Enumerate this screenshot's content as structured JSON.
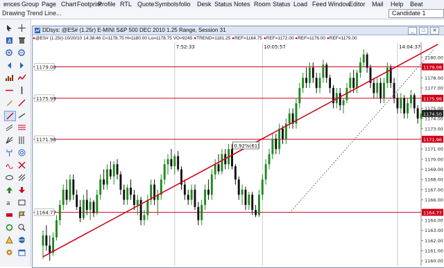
{
  "menu": [
    "ences",
    "Group",
    "Page",
    "Chart",
    "Footprint",
    "Profile",
    "RTL",
    "Quote",
    "Symbols",
    "folio",
    "Desk",
    "Status",
    "Notes",
    "Room",
    "Status",
    "Load",
    "Feed",
    "Window",
    "Editor",
    "Mail",
    "Help",
    "Beat"
  ],
  "status_bar": {
    "text": "Drawing Trend Line...",
    "symbol_box": "Candidate 1"
  },
  "chart_window": {
    "title": "DDsys: @ES# (1.25r) E-MINI S&P 500 DEC 2010 1.25 Range, Session 31",
    "info": {
      "symbol": "@ES# (1.25r)",
      "date": "10/20/10",
      "time": "14:38:46",
      "close": "C=1178.75",
      "high": "H=1180.00",
      "low": "Lo=1178.75",
      "volume": "VO=9245",
      "trend": "TREND=1181.25",
      "ref1": "REF=1164.75",
      "ref2": "REF=1172.00",
      "ref3": "REF=1176.00",
      "ref4": "REF=1179.00"
    },
    "colors": {
      "accent": "#d0021b",
      "window_border": "#7f93b5",
      "title_bg": "#dce6f4",
      "info_dot": "#d0021b",
      "bull": "#1f8a1f",
      "bear": "#111111"
    }
  },
  "chart_data": {
    "type": "candlestick",
    "y_axis_range": [
      1159.5,
      1181.5
    ],
    "y_ticks": [
      1180.0,
      1179.0,
      1178.0,
      1177.0,
      1176.0,
      1175.0,
      1174.0,
      1173.0,
      1172.0,
      1171.0,
      1170.0,
      1169.0,
      1168.0,
      1167.0,
      1166.0,
      1165.0,
      1164.0,
      1163.0,
      1162.0,
      1161.0,
      1160.0
    ],
    "ref_lines": [
      {
        "price": 1179.08,
        "label": "1179.08",
        "axis_label": "1179.08"
      },
      {
        "price": 1175.99,
        "label": "1175.99",
        "axis_label": "1175.99"
      },
      {
        "price": 1171.96,
        "label": "1171.96",
        "axis_label": "1171.96"
      },
      {
        "price": 1164.77,
        "label": "1164.77",
        "axis_label": "1164.77"
      }
    ],
    "last_price": "1174.50",
    "time_markers": [
      {
        "bar": 39,
        "label": "7:52:33"
      },
      {
        "bar": 65,
        "label": "10:05:57"
      },
      {
        "bar": 105,
        "label": "14:04:37"
      }
    ],
    "trend_line": {
      "from": {
        "bar": 0,
        "price": 1160.4
      },
      "to": {
        "bar": 117,
        "price": 1181.3
      }
    },
    "dotted_line": {
      "from": {
        "bar": 73,
        "price": 1164.7
      },
      "to": {
        "bar": 116,
        "price": 1180.9
      }
    },
    "annotation": "0.92%(61)",
    "candles": [
      {
        "o": 1161.5,
        "h": 1163.0,
        "l": 1160.2,
        "c": 1162.5
      },
      {
        "o": 1162.5,
        "h": 1163.5,
        "l": 1161.0,
        "c": 1161.5
      },
      {
        "o": 1161.5,
        "h": 1162.5,
        "l": 1160.0,
        "c": 1160.8
      },
      {
        "o": 1160.8,
        "h": 1162.8,
        "l": 1160.5,
        "c": 1162.3
      },
      {
        "o": 1162.3,
        "h": 1164.5,
        "l": 1162.0,
        "c": 1164.0
      },
      {
        "o": 1164.0,
        "h": 1166.0,
        "l": 1163.5,
        "c": 1165.5
      },
      {
        "o": 1165.5,
        "h": 1167.5,
        "l": 1165.0,
        "c": 1167.0
      },
      {
        "o": 1167.0,
        "h": 1168.0,
        "l": 1165.5,
        "c": 1166.0
      },
      {
        "o": 1166.0,
        "h": 1168.5,
        "l": 1165.8,
        "c": 1168.0
      },
      {
        "o": 1168.0,
        "h": 1168.5,
        "l": 1166.0,
        "c": 1166.5
      },
      {
        "o": 1166.5,
        "h": 1167.0,
        "l": 1165.0,
        "c": 1165.3
      },
      {
        "o": 1165.3,
        "h": 1166.0,
        "l": 1163.8,
        "c": 1164.2
      },
      {
        "o": 1164.2,
        "h": 1166.5,
        "l": 1164.0,
        "c": 1166.0
      },
      {
        "o": 1166.0,
        "h": 1167.0,
        "l": 1164.5,
        "c": 1165.0
      },
      {
        "o": 1165.0,
        "h": 1166.2,
        "l": 1164.0,
        "c": 1165.8
      },
      {
        "o": 1165.8,
        "h": 1166.0,
        "l": 1164.3,
        "c": 1164.7
      },
      {
        "o": 1164.7,
        "h": 1167.0,
        "l": 1164.5,
        "c": 1166.5
      },
      {
        "o": 1166.5,
        "h": 1168.5,
        "l": 1166.0,
        "c": 1168.0
      },
      {
        "o": 1168.0,
        "h": 1169.0,
        "l": 1167.0,
        "c": 1167.5
      },
      {
        "o": 1167.5,
        "h": 1169.5,
        "l": 1167.0,
        "c": 1169.0
      },
      {
        "o": 1169.0,
        "h": 1169.8,
        "l": 1168.0,
        "c": 1168.3
      },
      {
        "o": 1168.3,
        "h": 1169.8,
        "l": 1167.5,
        "c": 1169.5
      },
      {
        "o": 1169.5,
        "h": 1170.0,
        "l": 1168.0,
        "c": 1168.5
      },
      {
        "o": 1168.5,
        "h": 1168.8,
        "l": 1166.5,
        "c": 1167.0
      },
      {
        "o": 1167.0,
        "h": 1167.5,
        "l": 1165.5,
        "c": 1166.0
      },
      {
        "o": 1166.0,
        "h": 1167.5,
        "l": 1165.5,
        "c": 1167.2
      },
      {
        "o": 1167.2,
        "h": 1168.0,
        "l": 1166.0,
        "c": 1166.5
      },
      {
        "o": 1166.5,
        "h": 1167.0,
        "l": 1165.0,
        "c": 1165.5
      },
      {
        "o": 1165.5,
        "h": 1166.5,
        "l": 1164.5,
        "c": 1166.0
      },
      {
        "o": 1166.0,
        "h": 1166.3,
        "l": 1163.5,
        "c": 1164.0
      },
      {
        "o": 1164.0,
        "h": 1165.0,
        "l": 1163.5,
        "c": 1164.5
      },
      {
        "o": 1164.5,
        "h": 1166.5,
        "l": 1164.0,
        "c": 1166.0
      },
      {
        "o": 1166.0,
        "h": 1168.0,
        "l": 1165.5,
        "c": 1167.5
      },
      {
        "o": 1167.5,
        "h": 1168.0,
        "l": 1165.5,
        "c": 1166.0
      },
      {
        "o": 1166.0,
        "h": 1167.0,
        "l": 1164.5,
        "c": 1166.5
      },
      {
        "o": 1166.5,
        "h": 1168.5,
        "l": 1166.0,
        "c": 1168.0
      },
      {
        "o": 1168.0,
        "h": 1170.0,
        "l": 1167.5,
        "c": 1169.5
      },
      {
        "o": 1169.5,
        "h": 1170.5,
        "l": 1168.5,
        "c": 1170.0
      },
      {
        "o": 1170.0,
        "h": 1171.0,
        "l": 1169.0,
        "c": 1169.3
      },
      {
        "o": 1169.3,
        "h": 1170.5,
        "l": 1168.5,
        "c": 1170.3
      },
      {
        "o": 1170.3,
        "h": 1170.8,
        "l": 1168.8,
        "c": 1169.0
      },
      {
        "o": 1169.0,
        "h": 1169.3,
        "l": 1167.0,
        "c": 1167.5
      },
      {
        "o": 1167.5,
        "h": 1168.0,
        "l": 1166.0,
        "c": 1166.5
      },
      {
        "o": 1166.5,
        "h": 1167.0,
        "l": 1165.5,
        "c": 1166.0
      },
      {
        "o": 1166.0,
        "h": 1167.5,
        "l": 1165.5,
        "c": 1167.0
      },
      {
        "o": 1167.0,
        "h": 1167.5,
        "l": 1165.0,
        "c": 1165.3
      },
      {
        "o": 1165.3,
        "h": 1165.8,
        "l": 1163.5,
        "c": 1164.0
      },
      {
        "o": 1164.0,
        "h": 1166.0,
        "l": 1163.5,
        "c": 1165.5
      },
      {
        "o": 1165.5,
        "h": 1167.5,
        "l": 1165.0,
        "c": 1167.0
      },
      {
        "o": 1167.0,
        "h": 1168.0,
        "l": 1166.0,
        "c": 1166.5
      },
      {
        "o": 1166.5,
        "h": 1169.0,
        "l": 1166.0,
        "c": 1168.5
      },
      {
        "o": 1168.5,
        "h": 1170.0,
        "l": 1168.0,
        "c": 1169.5
      },
      {
        "o": 1169.5,
        "h": 1170.5,
        "l": 1168.5,
        "c": 1168.8
      },
      {
        "o": 1168.8,
        "h": 1171.0,
        "l": 1168.5,
        "c": 1170.5
      },
      {
        "o": 1170.5,
        "h": 1171.0,
        "l": 1169.0,
        "c": 1169.5
      },
      {
        "o": 1169.5,
        "h": 1171.5,
        "l": 1169.0,
        "c": 1171.0
      },
      {
        "o": 1171.0,
        "h": 1171.5,
        "l": 1169.0,
        "c": 1169.3
      },
      {
        "o": 1169.3,
        "h": 1169.5,
        "l": 1167.5,
        "c": 1168.0
      },
      {
        "o": 1168.0,
        "h": 1168.3,
        "l": 1166.0,
        "c": 1166.5
      },
      {
        "o": 1166.5,
        "h": 1167.5,
        "l": 1165.5,
        "c": 1167.0
      },
      {
        "o": 1167.0,
        "h": 1167.3,
        "l": 1165.0,
        "c": 1165.5
      },
      {
        "o": 1165.5,
        "h": 1166.8,
        "l": 1165.0,
        "c": 1166.5
      },
      {
        "o": 1166.5,
        "h": 1166.8,
        "l": 1164.5,
        "c": 1165.0
      },
      {
        "o": 1165.0,
        "h": 1165.5,
        "l": 1164.3,
        "c": 1164.5
      },
      {
        "o": 1164.5,
        "h": 1167.0,
        "l": 1164.3,
        "c": 1166.5
      },
      {
        "o": 1166.5,
        "h": 1168.5,
        "l": 1166.0,
        "c": 1168.0
      },
      {
        "o": 1168.0,
        "h": 1170.0,
        "l": 1167.5,
        "c": 1169.5
      },
      {
        "o": 1169.5,
        "h": 1171.0,
        "l": 1169.0,
        "c": 1170.5
      },
      {
        "o": 1170.5,
        "h": 1172.5,
        "l": 1170.0,
        "c": 1172.0
      },
      {
        "o": 1172.0,
        "h": 1172.5,
        "l": 1170.5,
        "c": 1171.0
      },
      {
        "o": 1171.0,
        "h": 1173.5,
        "l": 1170.5,
        "c": 1173.0
      },
      {
        "o": 1173.0,
        "h": 1173.3,
        "l": 1171.5,
        "c": 1172.0
      },
      {
        "o": 1172.0,
        "h": 1174.0,
        "l": 1171.5,
        "c": 1173.5
      },
      {
        "o": 1173.5,
        "h": 1175.0,
        "l": 1173.0,
        "c": 1174.5
      },
      {
        "o": 1174.5,
        "h": 1175.0,
        "l": 1173.0,
        "c": 1173.5
      },
      {
        "o": 1173.5,
        "h": 1176.0,
        "l": 1173.0,
        "c": 1175.5
      },
      {
        "o": 1175.5,
        "h": 1177.5,
        "l": 1175.0,
        "c": 1177.0
      },
      {
        "o": 1177.0,
        "h": 1178.5,
        "l": 1176.5,
        "c": 1178.0
      },
      {
        "o": 1178.0,
        "h": 1179.0,
        "l": 1177.0,
        "c": 1177.5
      },
      {
        "o": 1177.5,
        "h": 1179.5,
        "l": 1177.0,
        "c": 1179.0
      },
      {
        "o": 1179.0,
        "h": 1179.5,
        "l": 1177.5,
        "c": 1178.0
      },
      {
        "o": 1178.0,
        "h": 1178.5,
        "l": 1176.5,
        "c": 1177.0
      },
      {
        "o": 1177.0,
        "h": 1178.5,
        "l": 1176.5,
        "c": 1178.0
      },
      {
        "o": 1178.0,
        "h": 1179.8,
        "l": 1177.5,
        "c": 1179.3
      },
      {
        "o": 1179.3,
        "h": 1179.5,
        "l": 1177.5,
        "c": 1178.0
      },
      {
        "o": 1178.0,
        "h": 1178.3,
        "l": 1176.5,
        "c": 1177.0
      },
      {
        "o": 1177.0,
        "h": 1177.3,
        "l": 1175.0,
        "c": 1175.5
      },
      {
        "o": 1175.5,
        "h": 1177.0,
        "l": 1175.0,
        "c": 1176.5
      },
      {
        "o": 1176.5,
        "h": 1177.0,
        "l": 1174.8,
        "c": 1175.3
      },
      {
        "o": 1175.3,
        "h": 1176.0,
        "l": 1174.5,
        "c": 1175.8
      },
      {
        "o": 1175.8,
        "h": 1177.5,
        "l": 1175.5,
        "c": 1177.0
      },
      {
        "o": 1177.0,
        "h": 1178.5,
        "l": 1176.5,
        "c": 1178.0
      },
      {
        "o": 1178.0,
        "h": 1178.8,
        "l": 1176.5,
        "c": 1177.0
      },
      {
        "o": 1177.0,
        "h": 1178.8,
        "l": 1176.5,
        "c": 1178.5
      },
      {
        "o": 1178.5,
        "h": 1180.0,
        "l": 1178.0,
        "c": 1179.5
      },
      {
        "o": 1179.5,
        "h": 1180.8,
        "l": 1179.0,
        "c": 1180.3
      },
      {
        "o": 1180.3,
        "h": 1180.5,
        "l": 1178.5,
        "c": 1179.0
      },
      {
        "o": 1179.0,
        "h": 1179.3,
        "l": 1177.0,
        "c": 1177.5
      },
      {
        "o": 1177.5,
        "h": 1178.0,
        "l": 1176.0,
        "c": 1176.5
      },
      {
        "o": 1176.5,
        "h": 1178.0,
        "l": 1176.0,
        "c": 1177.5
      },
      {
        "o": 1177.5,
        "h": 1178.0,
        "l": 1175.5,
        "c": 1176.0
      },
      {
        "o": 1176.0,
        "h": 1178.0,
        "l": 1175.5,
        "c": 1177.5
      },
      {
        "o": 1177.5,
        "h": 1179.5,
        "l": 1177.0,
        "c": 1179.0
      },
      {
        "o": 1179.0,
        "h": 1179.3,
        "l": 1177.0,
        "c": 1177.5
      },
      {
        "o": 1177.5,
        "h": 1178.0,
        "l": 1175.5,
        "c": 1176.0
      },
      {
        "o": 1176.0,
        "h": 1176.5,
        "l": 1174.5,
        "c": 1175.0
      },
      {
        "o": 1175.0,
        "h": 1176.5,
        "l": 1174.5,
        "c": 1176.0
      },
      {
        "o": 1176.0,
        "h": 1176.3,
        "l": 1174.0,
        "c": 1174.5
      },
      {
        "o": 1174.5,
        "h": 1176.0,
        "l": 1174.0,
        "c": 1175.5
      },
      {
        "o": 1175.5,
        "h": 1176.8,
        "l": 1175.0,
        "c": 1176.3
      },
      {
        "o": 1176.3,
        "h": 1176.5,
        "l": 1174.5,
        "c": 1175.0
      },
      {
        "o": 1175.0,
        "h": 1175.3,
        "l": 1173.5,
        "c": 1174.0
      },
      {
        "o": 1174.0,
        "h": 1175.0,
        "l": 1173.0,
        "c": 1174.5
      }
    ]
  }
}
